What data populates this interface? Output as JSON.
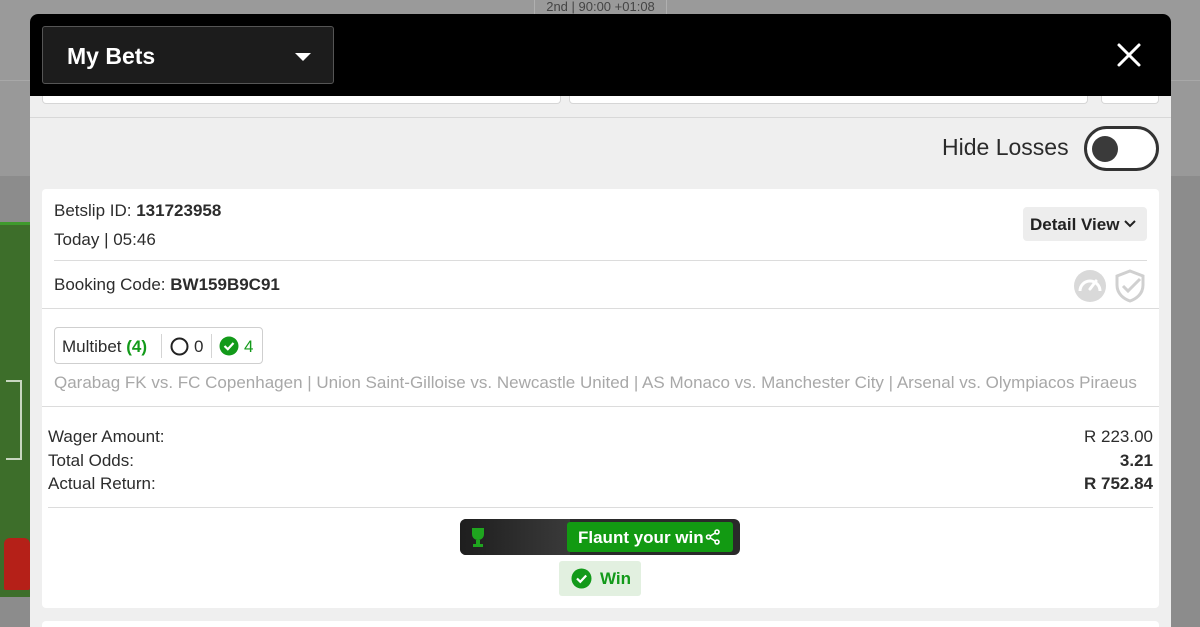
{
  "background": {
    "match_clock": "2nd | 90:00 +01:08"
  },
  "header": {
    "title": "My Bets",
    "close_icon": "close-icon"
  },
  "filters": {
    "hide_losses_label": "Hide Losses",
    "hide_losses_enabled": false
  },
  "bet": {
    "betslip_label": "Betslip ID:",
    "betslip_id": "131723958",
    "datetime": "Today | 05:46",
    "detail_view_label": "Detail View",
    "booking_label": "Booking Code:",
    "booking_code": "BW159B9C91",
    "multibet_label": "Multibet",
    "multibet_count": "(4)",
    "open_count": "0",
    "won_count": "4",
    "matches": "Qarabag FK vs. FC Copenhagen | Union Saint-Gilloise vs. Newcastle United | AS Monaco vs. Manchester City | Arsenal vs. Olympiacos Piraeus",
    "wager_label": "Wager Amount:",
    "wager_value": "R 223.00",
    "odds_label": "Total Odds:",
    "odds_value": "3.21",
    "return_label": "Actual Return:",
    "return_value": "R 752.84",
    "flaunt_label": "Flaunt your win",
    "status_label": "Win"
  },
  "colors": {
    "accent_green": "#139a1a",
    "header_bg": "#000000",
    "win_badge_bg": "#e2f0e0"
  }
}
